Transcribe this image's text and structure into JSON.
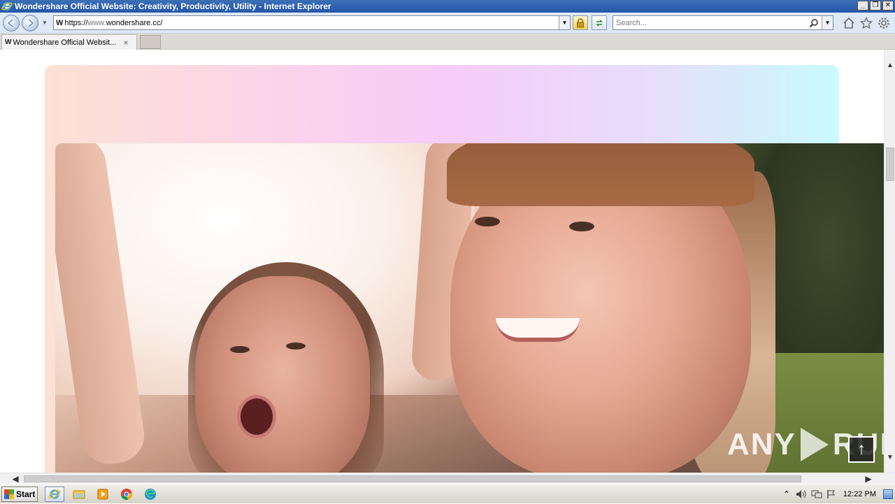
{
  "window": {
    "title": "Wondershare Official Website: Creativity, Productivity, Utility - Internet Explorer",
    "buttons": [
      "minimize",
      "restore",
      "close"
    ]
  },
  "toolbar": {
    "back_icon": "back-arrow-icon",
    "forward_icon": "forward-arrow-icon",
    "site_logo": "W",
    "url_prefix": "https://",
    "url_www": "www.",
    "url_domain": "wondershare.cc/",
    "search_placeholder": "Search..."
  },
  "tab": {
    "label": "Wondershare Official Websit...",
    "close": "×"
  },
  "page": {
    "gradient_colors": [
      "#fde1d4",
      "#f7ccf8",
      "#c9fafd"
    ],
    "back_to_top": "↑"
  },
  "watermark": {
    "left": "ANY",
    "right": "RUN"
  },
  "taskbar": {
    "start_label": "Start",
    "clock": "12:22 PM"
  }
}
